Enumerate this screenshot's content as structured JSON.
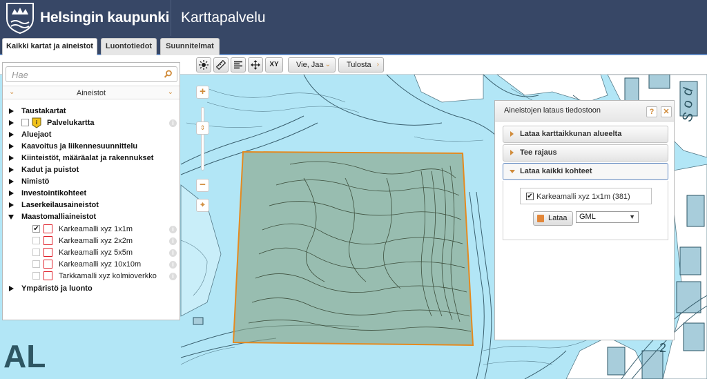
{
  "header": {
    "brand": "Helsingin kaupunki",
    "service": "Karttapalvelu"
  },
  "tabs": [
    {
      "label": "Kaikki kartat ja aineistot",
      "active": true
    },
    {
      "label": "Luontotiedot",
      "active": false
    },
    {
      "label": "Suunnitelmat",
      "active": false
    }
  ],
  "toolbar": {
    "icons": [
      "sun-icon",
      "ruler-icon",
      "lines-icon",
      "move-icon",
      "xy-icon"
    ],
    "xy_label": "XY",
    "share_label": "Vie, Jaa",
    "print_label": "Tulosta"
  },
  "sidebar": {
    "search_placeholder": "Hae",
    "section_title": "Aineistot",
    "items": [
      {
        "label": "Taustakartat",
        "expanded": false
      },
      {
        "label": "Palvelukartta",
        "expanded": false,
        "checkbox": false
      },
      {
        "label": "Aluejaot",
        "expanded": false
      },
      {
        "label": "Kaavoitus ja liikennesuunnittelu",
        "expanded": false
      },
      {
        "label": "Kiinteistöt, määräalat ja rakennukset",
        "expanded": false
      },
      {
        "label": "Kadut ja puistot",
        "expanded": false
      },
      {
        "label": "Nimistö",
        "expanded": false
      },
      {
        "label": "Investointikohteet",
        "expanded": false
      },
      {
        "label": "Laserkeilausaineistot",
        "expanded": false
      },
      {
        "label": "Maastomalliaineistot",
        "expanded": true
      },
      {
        "label": "Ympäristö ja luonto",
        "expanded": false
      }
    ],
    "subitems": [
      {
        "label": "Karkeamalli xyz 1x1m",
        "checked": true
      },
      {
        "label": "Karkeamalli xyz 2x2m",
        "checked": false
      },
      {
        "label": "Karkeamalli xyz 5x5m",
        "checked": false
      },
      {
        "label": "Karkeamalli xyz 10x10m",
        "checked": false
      },
      {
        "label": "Tarkkamalli xyz kolmioverkko",
        "checked": false
      }
    ]
  },
  "dialog": {
    "title": "Aineistojen lataus tiedostoon",
    "help_label": "?",
    "close_label": "✕",
    "sections": [
      {
        "label": "Lataa karttaikkunan alueelta",
        "expanded": false
      },
      {
        "label": "Tee rajaus",
        "expanded": false
      },
      {
        "label": "Lataa kaikki kohteet",
        "expanded": true
      }
    ],
    "download_item": "Karkeamalli xyz 1x1m (381)",
    "download_checked": true,
    "download_button": "Lataa",
    "format_value": "GML"
  },
  "map": {
    "water_color": "#b2e6f6",
    "land_color": "#ffffff",
    "selection_fill": "#8aa88a",
    "selection_stroke": "#e58a1f",
    "map_text_1": "AL",
    "map_text_2": "2",
    "road_labels": [
      "S",
      "o",
      "d"
    ]
  },
  "colors": {
    "header_bg": "#374766",
    "accent": "#d08b3a",
    "layer_square": "#e0202a"
  }
}
